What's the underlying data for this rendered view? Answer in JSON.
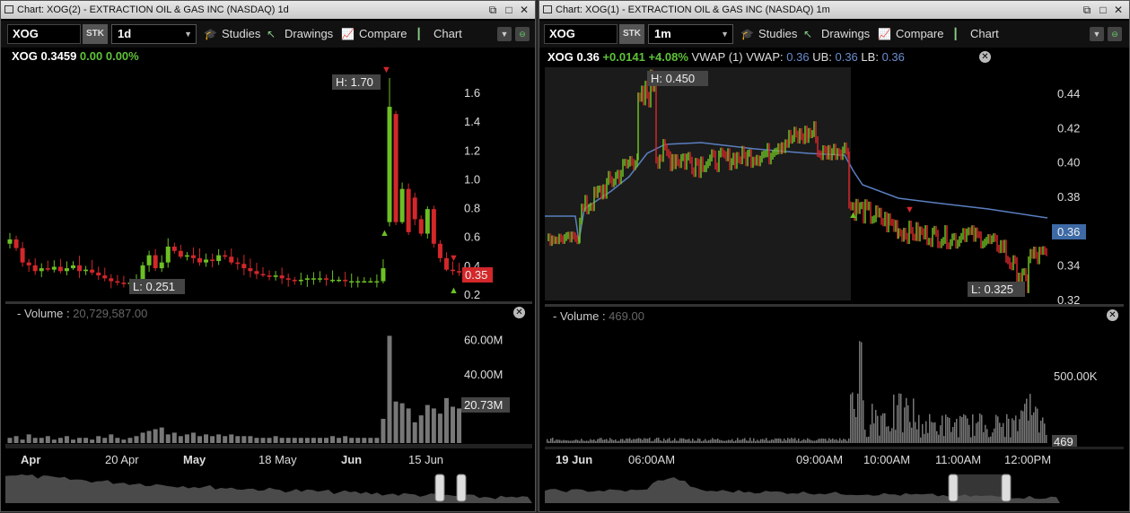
{
  "colors": {
    "up": "#6cc024",
    "down": "#d3272a",
    "vwap": "#5a7fc0",
    "volume": "#777777"
  },
  "left": {
    "title": "Chart: XOG(2) - EXTRACTION OIL & GAS INC (NASDAQ) 1d",
    "symbol": "XOG",
    "type_badge": "STK",
    "interval": "1d",
    "menu": {
      "studies": "Studies",
      "drawings": "Drawings",
      "compare": "Compare",
      "chart": "Chart"
    },
    "quote": {
      "symbol": "XOG",
      "price": "0.3459",
      "change": "0.00",
      "pct": "0.00%"
    },
    "high_label": "H: 1.70",
    "low_label": "L: 0.251",
    "last_price_tag": "0.35",
    "y_ticks": [
      "1.6",
      "1.4",
      "1.2",
      "1.0",
      "0.8",
      "0.6",
      "0.4",
      "0.2"
    ],
    "volume_label": "Volume",
    "volume_value": "20,729,587.00",
    "volume_ticks": [
      "60.00M",
      "40.00M"
    ],
    "volume_tag": "20.73M",
    "x_labels": [
      "Apr",
      "20 Apr",
      "May",
      "18 May",
      "Jun",
      "15 Jun"
    ],
    "x_bold": [
      true,
      false,
      true,
      false,
      true,
      false
    ]
  },
  "right": {
    "title": "Chart: XOG(1) - EXTRACTION OIL & GAS INC (NASDAQ) 1m",
    "symbol": "XOG",
    "type_badge": "STK",
    "interval": "1m",
    "menu": {
      "studies": "Studies",
      "drawings": "Drawings",
      "compare": "Compare",
      "chart": "Chart"
    },
    "quote": {
      "symbol": "XOG",
      "price": "0.36",
      "change": "+0.0141",
      "pct": "+4.08%",
      "vwap_text": "VWAP (1) VWAP:",
      "vwap": "0.36",
      "ub_label": "UB:",
      "ub": "0.36",
      "lb_label": "LB:",
      "lb": "0.36"
    },
    "high_label": "H: 0.450",
    "low_label": "L: 0.325",
    "last_price_tag": "0.36",
    "y_ticks": [
      "0.44",
      "0.42",
      "0.40",
      "0.38",
      "0.34",
      "0.32"
    ],
    "volume_label": "Volume",
    "volume_value": "469.00",
    "volume_ticks": [
      "500.00K"
    ],
    "volume_tag": "469",
    "x_labels": [
      "19 Jun",
      "06:00AM",
      "09:00AM",
      "10:00AM",
      "11:00AM",
      "12:00PM"
    ],
    "x_bold": [
      true,
      false,
      false,
      false,
      false,
      false
    ]
  }
}
